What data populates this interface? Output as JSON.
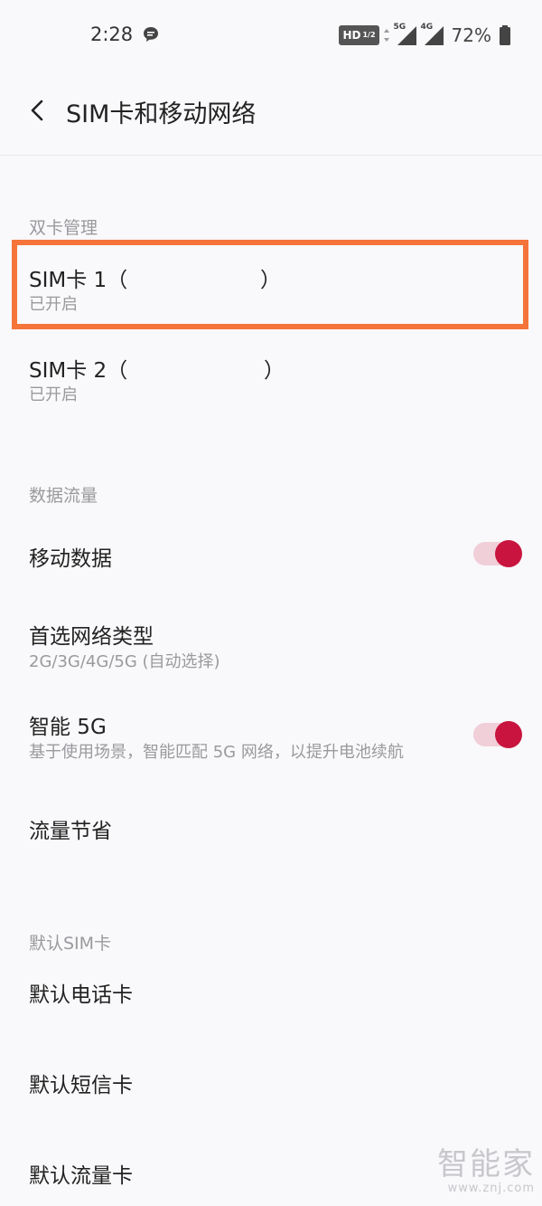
{
  "status_bar": {
    "time": "2:28",
    "hd_label": "HD",
    "hd_fraction": "1/2",
    "signal_1_label": "5G",
    "signal_2_label": "4G",
    "battery": "72%"
  },
  "header": {
    "title": "SIM卡和移动网络"
  },
  "dual_sim": {
    "section_label": "双卡管理",
    "sim1": {
      "title": "SIM卡 1（",
      "title_end": "）",
      "status": "已开启"
    },
    "sim2": {
      "title": "SIM卡 2（",
      "title_end": "）",
      "status": "已开启"
    }
  },
  "data_usage": {
    "section_label": "数据流量",
    "mobile_data": {
      "label": "移动数据",
      "enabled": true
    },
    "preferred_network": {
      "label": "首选网络类型",
      "value": "2G/3G/4G/5G (自动选择)"
    },
    "smart_5g": {
      "label": "智能 5G",
      "description": "基于使用场景，智能匹配 5G 网络，以提升电池续航",
      "enabled": true
    },
    "data_saver": {
      "label": "流量节省"
    }
  },
  "default_sim": {
    "section_label": "默认SIM卡",
    "call_sim": "默认电话卡",
    "sms_sim": "默认短信卡",
    "data_sim": "默认流量卡"
  },
  "watermark": {
    "name": "智能家",
    "url": "www.znj.com"
  },
  "colors": {
    "accent": "#c8143e",
    "highlight": "#f4743a"
  }
}
